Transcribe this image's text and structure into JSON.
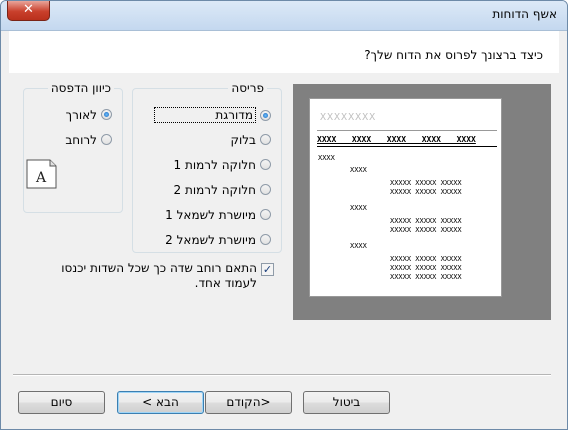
{
  "window": {
    "title": "אשף הדוחות",
    "close_glyph": "✕"
  },
  "question": "כיצד ברצונך לפרוס את הדוח שלך?",
  "layout_group": {
    "legend": "פריסה",
    "options": [
      {
        "label": "מדורגת",
        "selected": true
      },
      {
        "label": "בלוק",
        "selected": false
      },
      {
        "label": "חלוקה לרמות 1",
        "selected": false
      },
      {
        "label": "חלוקה לרמות 2",
        "selected": false
      },
      {
        "label": "מיושרת לשמאל 1",
        "selected": false
      },
      {
        "label": "מיושרת לשמאל 2",
        "selected": false
      }
    ]
  },
  "orientation_group": {
    "legend": "כיוון הדפסה",
    "options": [
      {
        "label": "לאורך",
        "selected": true
      },
      {
        "label": "לרוחב",
        "selected": false
      }
    ],
    "icon": "page-icon",
    "icon_letter": "A"
  },
  "fit_checkbox": {
    "checked": true,
    "label": "התאם רוחב שדה כך שכל השדות יכנסו לעמוד אחד."
  },
  "preview": {
    "title": "XXXXXXXX",
    "header_row": "XXXX  XXXX  XXXX  XXXX  XXXX",
    "group1": "XXXX",
    "group2": "XXXX",
    "detail": "XXXXX XXXXX XXXXX"
  },
  "buttons": {
    "cancel": "ביטול",
    "back": "<הקודם",
    "next": "הבא >",
    "finish": "סיום"
  },
  "colors": {
    "title_bar": "#c4d8ef",
    "preview_bg": "#808080",
    "close_button": "#c9402c"
  }
}
